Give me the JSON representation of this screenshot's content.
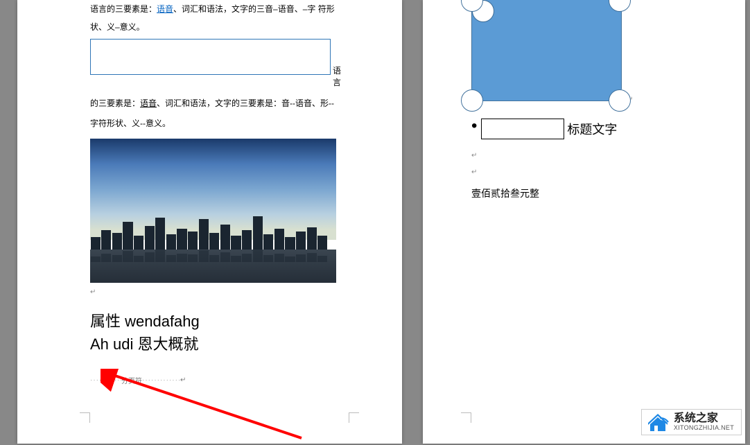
{
  "page_left": {
    "paragraph1_part1": "语言的三要素是：",
    "paragraph1_link": "语音",
    "paragraph1_part2": "、词汇和语法，文字的三音–语音、–字 符形状、义–意义。",
    "textbox_trailing": "语言",
    "paragraph2_part1": "的三要素是：",
    "paragraph2_underline": "语音",
    "paragraph2_part2": "、词汇和语法，文字的三要素是：音--语音、形--字符形状、义--意义。",
    "para_mark": "↵",
    "heading_line1": "属性 wendafahg",
    "heading_line2": "Ah udi 恩大概就",
    "page_break_label": "分页符",
    "page_break_mark": "↵"
  },
  "page_right": {
    "shape_trail_mark": "↵",
    "caption_label": "标题文字",
    "small_mark1": "↵",
    "small_mark2": "↵",
    "amount_text": "壹佰贰拾叁元整"
  },
  "watermark": {
    "title": "系统之家",
    "url": "XITONGZHIJIA.NET"
  }
}
